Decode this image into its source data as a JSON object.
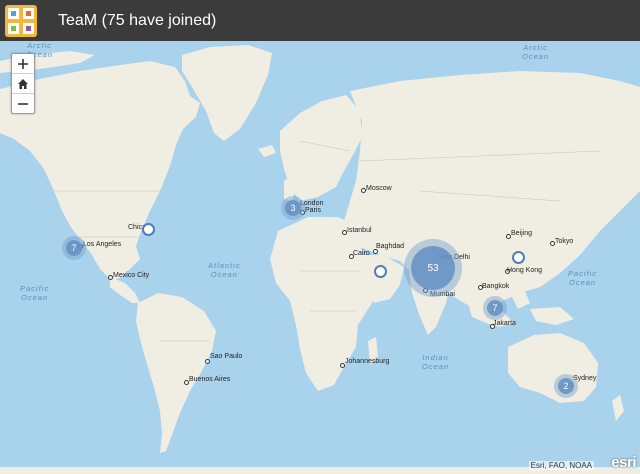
{
  "header": {
    "title": "TeaM (75 have joined)",
    "logo_icon": "puzzle-app-icon"
  },
  "zoom": {
    "zoom_in_icon": "plus-icon",
    "home_icon": "home-icon",
    "zoom_out_icon": "minus-icon"
  },
  "oceans": {
    "arctic_left": "Arctic\nOcean",
    "arctic_right": "Arctic\nOcean",
    "pacific_left": "Pacific\nOcean",
    "pacific_right": "Pacific\nOcean",
    "atlantic": "Atlantic\nOcean",
    "indian": "Indian\nOcean"
  },
  "cities": {
    "moscow": "Moscow",
    "london": "London",
    "paris": "Paris",
    "istanbul": "Istanbul",
    "beijing": "Beijing",
    "tokyo": "Tokyo",
    "baghdad": "Baghdad",
    "cairo": "Cairo",
    "new_delhi": "New Delhi",
    "hong_kong": "Hong Kong",
    "bangkok": "Bangkok",
    "mumbai": "Mumbai",
    "jakarta": "Jakarta",
    "chicago": "Chicago",
    "los_angeles": "Los Angeles",
    "mexico_city": "Mexico City",
    "sao_paulo": "Sao Paulo",
    "buenos_aires": "Buenos Aires",
    "johannesburg": "Johannesburg",
    "sydney": "Sydney"
  },
  "clusters": {
    "india": "53",
    "los_angeles": "7",
    "europe": "3",
    "jakarta": "7",
    "sydney": "2"
  },
  "attribution": "Esri, FAO, NOAA",
  "esri_logo": "esri",
  "colors": {
    "ocean": "#a9d2ed",
    "land": "#f0ede3",
    "header": "#3b3b3b",
    "cluster": "#6491c3",
    "marker_border": "#4d7eb7"
  }
}
